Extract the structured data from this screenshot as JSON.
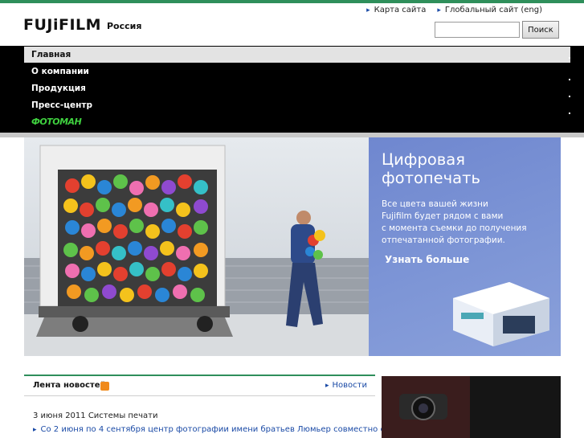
{
  "header": {
    "logo": "FUJiFILM",
    "region": "Россия",
    "links": [
      "Карта сайта",
      "Глобальный сайт (eng)"
    ],
    "search_button": "Поиск",
    "search_value": ""
  },
  "nav": {
    "items": [
      "Главная",
      "О компании",
      "Продукция",
      "Пресс-центр"
    ],
    "photo_item": "ФОТОМАН",
    "active_index": 0
  },
  "hero": {
    "title": "Цифровая фотопечать",
    "text_lines": [
      "Все цвета вашей жизни",
      "Fujifilm будет рядом с вами",
      "с момента съемки до получения",
      "отпечатанной фотографии."
    ],
    "more_label": "Узнать больше"
  },
  "news": {
    "title": "Лента новостей",
    "more_label": "Новости",
    "date_line": "3 июня 2011 Системы печати",
    "item": "Со 2 июня по 4 сентября центр фотографии имени братьев Люмьер совместно с"
  },
  "colors": {
    "accent": "#2f8f5b",
    "link": "#1a4aa6",
    "hero_panel": "#7d95d6",
    "rss": "#f08a1b"
  }
}
